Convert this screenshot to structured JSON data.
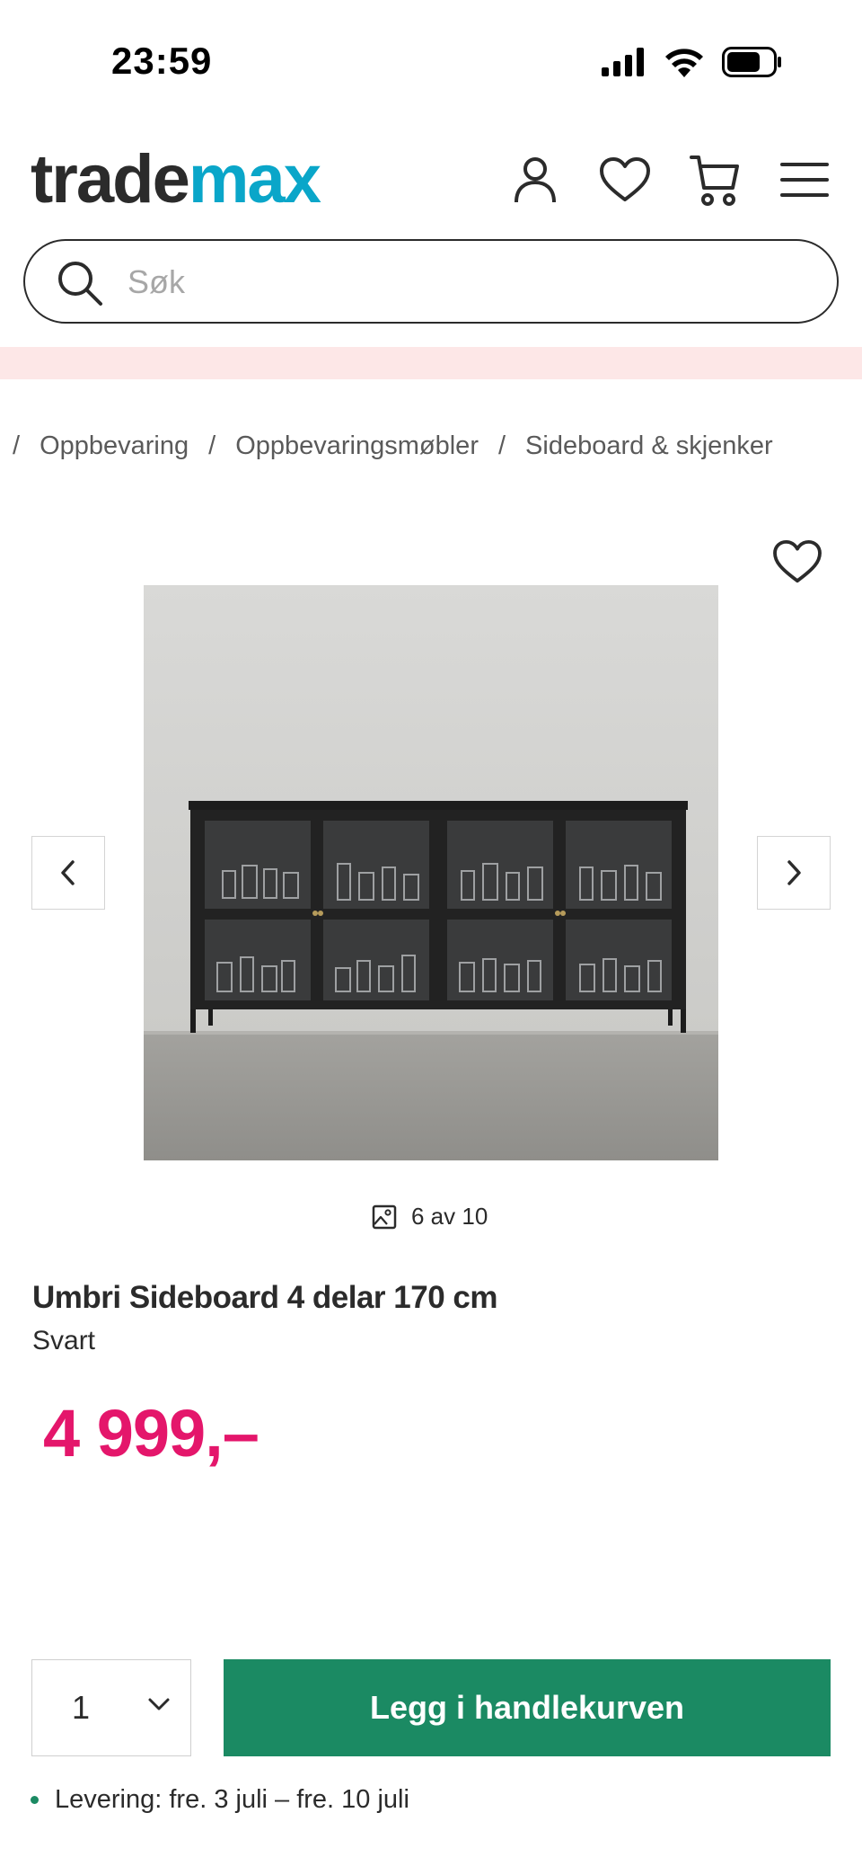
{
  "status_bar": {
    "time": "23:59"
  },
  "header": {
    "logo_part1": "trade",
    "logo_part2": "max",
    "icons": [
      "account-icon",
      "heart-icon",
      "cart-icon",
      "menu-icon"
    ]
  },
  "search": {
    "placeholder": "Søk",
    "value": ""
  },
  "breadcrumb": {
    "separator": "/",
    "items": [
      "Oppbevaring",
      "Oppbevaringsmøbler",
      "Sideboard & skjenker"
    ]
  },
  "gallery": {
    "counter": "6 av 10"
  },
  "product": {
    "title": "Umbri Sideboard 4 delar 170 cm",
    "variant": "Svart",
    "price": "4 999,–"
  },
  "purchase": {
    "quantity": "1",
    "add_to_cart_label": "Legg i handlekurven"
  },
  "delivery": {
    "text": "Levering: fre. 3 juli – fre. 10 juli"
  },
  "colors": {
    "brand_dark": "#2b2b2b",
    "brand_accent": "#0aa6c9",
    "price": "#e4166b",
    "cta": "#1b8a63",
    "promo_bg": "#fde7e7"
  }
}
